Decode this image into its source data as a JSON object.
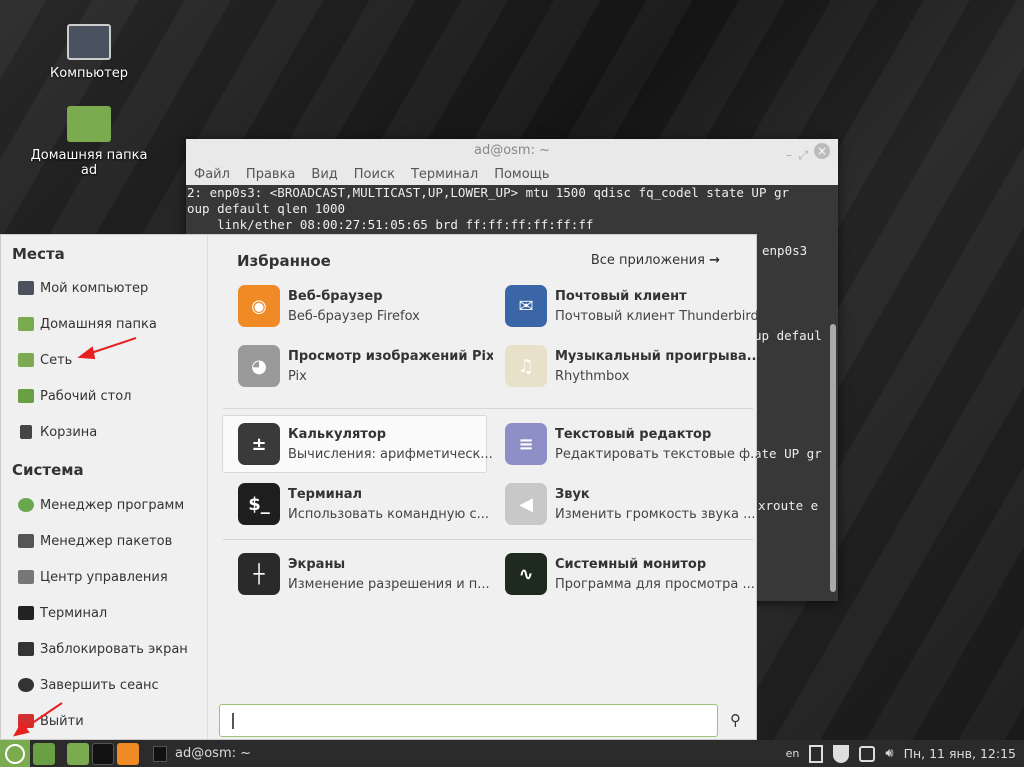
{
  "desktop": {
    "icons": [
      {
        "label": "Компьютер"
      },
      {
        "label": "Домашняя папка ad"
      }
    ]
  },
  "terminal": {
    "title": "ad@osm: ~",
    "menu": [
      "Файл",
      "Правка",
      "Вид",
      "Поиск",
      "Терминал",
      "Помощь"
    ],
    "lines": [
      "2: enp0s3: <BROADCAST,MULTICAST,UP,LOWER_UP> mtu 1500 qdisc fq_codel state UP gr",
      "oup default qlen 1000",
      "    link/ether 08:00:27:51:05:65 brd ff:ff:ff:ff:ff:ff"
    ],
    "fragments": [
      "enp0s3",
      "up defaul",
      "ate UP gr",
      "xroute e"
    ]
  },
  "menu": {
    "places_title": "Места",
    "places": [
      "Мой компьютер",
      "Домашняя папка",
      "Сеть",
      "Рабочий стол",
      "Корзина"
    ],
    "system_title": "Система",
    "system": [
      "Менеджер программ",
      "Менеджер пакетов",
      "Центр управления",
      "Терминал",
      "Заблокировать экран",
      "Завершить сеанс",
      "Выйти"
    ],
    "favorites_title": "Избранное",
    "all_apps": "Все приложения",
    "apps": [
      {
        "name": "Веб-браузер",
        "desc": "Веб-браузер Firefox",
        "color": "#f08a24"
      },
      {
        "name": "Почтовый клиент",
        "desc": "Почтовый клиент Thunderbird",
        "color": "#3a66a8"
      },
      {
        "name": "Просмотр изображений Pix",
        "desc": "Pix",
        "color": "#9a9a9a"
      },
      {
        "name": "Музыкальный проигрыва...",
        "desc": "Rhythmbox",
        "color": "#e8e0c8"
      },
      {
        "name": "Калькулятор",
        "desc": "Вычисления: арифметическ...",
        "color": "#3a3a3a"
      },
      {
        "name": "Текстовый редактор",
        "desc": "Редактировать текстовые ф...",
        "color": "#8f8fc8"
      },
      {
        "name": "Терминал",
        "desc": "Использовать командную с...",
        "color": "#1e1e1e"
      },
      {
        "name": "Звук",
        "desc": "Изменить громкость звука ...",
        "color": "#c8c8c8"
      },
      {
        "name": "Экраны",
        "desc": "Изменение разрешения и п...",
        "color": "#2a2a2a"
      },
      {
        "name": "Системный монитор",
        "desc": "Программа для просмотра ...",
        "color": "#1e2a1e"
      }
    ],
    "search_value": ""
  },
  "panel": {
    "task": "ad@osm: ~",
    "lang": "en",
    "clock": "Пн, 11 янв, 12:15"
  }
}
